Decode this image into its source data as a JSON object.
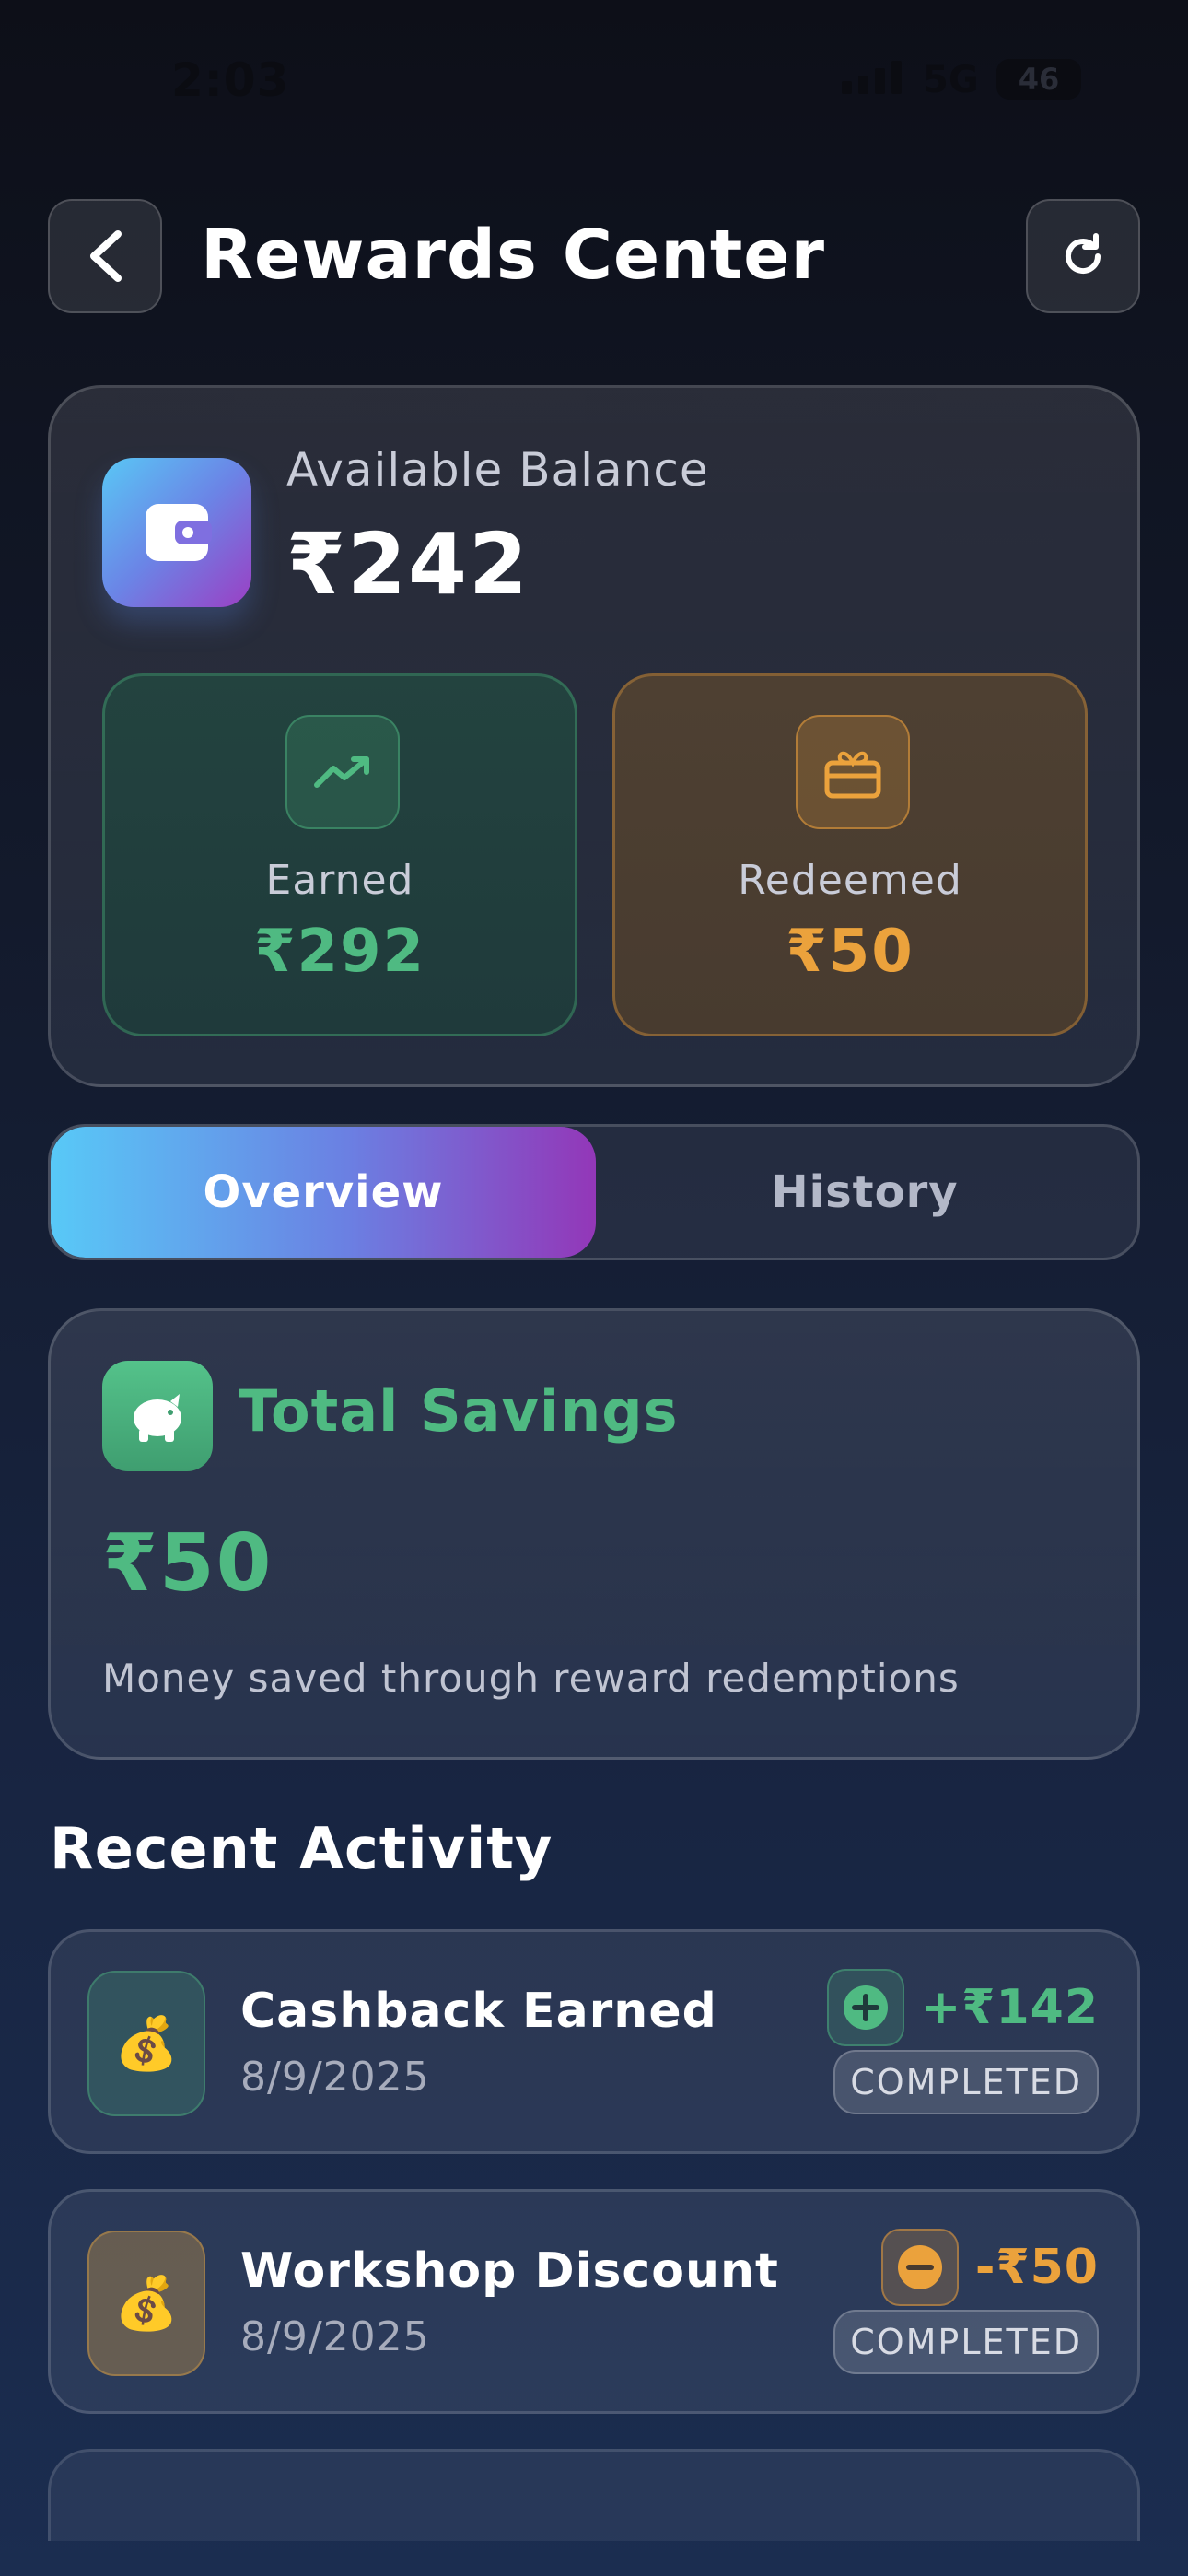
{
  "status_bar": {
    "time": "2:03",
    "network": "5G",
    "battery": "46"
  },
  "header": {
    "title": "Rewards Center"
  },
  "balance": {
    "label": "Available Balance",
    "value": "₹242",
    "earned": {
      "label": "Earned",
      "value": "₹292"
    },
    "redeemed": {
      "label": "Redeemed",
      "value": "₹50"
    }
  },
  "tabs": [
    {
      "label": "Overview",
      "active": true
    },
    {
      "label": "History",
      "active": false
    }
  ],
  "savings": {
    "title": "Total Savings",
    "value": "₹50",
    "description": "Money saved through reward redemptions"
  },
  "recent_activity": {
    "title": "Recent Activity",
    "items": [
      {
        "title": "Cashback Earned",
        "date": "8/9/2025",
        "amount": "+₹142",
        "status": "COMPLETED",
        "icon": "money-bag-icon"
      },
      {
        "title": "Workshop Discount",
        "date": "8/9/2025",
        "amount": "-₹50",
        "status": "COMPLETED",
        "icon": "money-bag-icon"
      }
    ]
  },
  "colors": {
    "green": "#4fba82",
    "orange": "#eba23c",
    "accent_start": "#58c9f7",
    "accent_end": "#9337b8"
  }
}
